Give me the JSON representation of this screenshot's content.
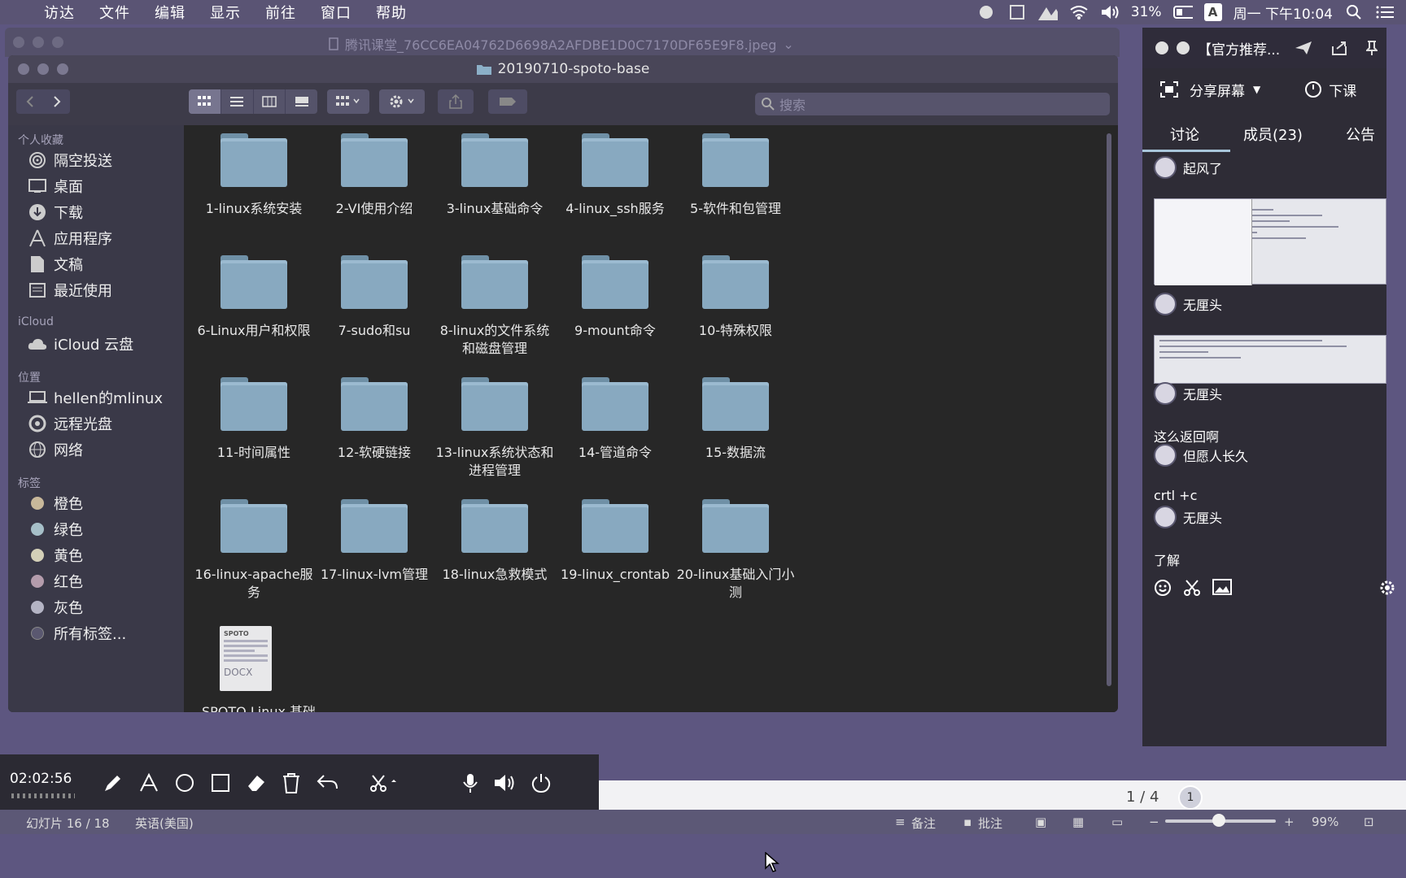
{
  "menubar": {
    "menus": [
      "访达",
      "文件",
      "编辑",
      "显示",
      "前往",
      "窗口",
      "帮助"
    ],
    "battery": "31%",
    "input_method": "A",
    "datetime": "周一 下午10:04"
  },
  "preview_window": {
    "title": "腾讯课堂_76CC6EA04762D6698A2AFDBE1D0C7170DF65E9F8.jpeg"
  },
  "finder": {
    "title": "20190710-spoto-base",
    "search_placeholder": "搜索",
    "sidebar": {
      "favorites_header": "个人收藏",
      "favorites": [
        "隔空投送",
        "桌面",
        "下载",
        "应用程序",
        "文稿",
        "最近使用"
      ],
      "icloud_header": "iCloud",
      "icloud_items": [
        "iCloud 云盘"
      ],
      "locations_header": "位置",
      "locations": [
        "hellen的mlinux",
        "远程光盘",
        "网络"
      ],
      "tags_header": "标签",
      "tags": [
        {
          "label": "橙色",
          "color": "#c8b89a"
        },
        {
          "label": "绿色",
          "color": "#a6bfc8"
        },
        {
          "label": "黄色",
          "color": "#d4d0b8"
        },
        {
          "label": "红色",
          "color": "#b49cac"
        },
        {
          "label": "灰色",
          "color": "#b4b4c4"
        }
      ],
      "all_tags": "所有标签..."
    },
    "folders": [
      "1-linux系统安装",
      "2-VI使用介绍",
      "3-linux基础命令",
      "4-linux_ssh服务",
      "5-软件和包管理",
      "6-Linux用户和权限",
      "7-sudo和su",
      "8-linux的文件系统和磁盘管理",
      "9-mount命令",
      "10-特殊权限",
      "11-时间属性",
      "12-软硬链接",
      "13-linux系统状态和进程管理",
      "14-管道命令",
      "15-数据流",
      "16-linux-apache服务",
      "17-linux-lvm管理",
      "18-linux急救模式",
      "19-linux_crontab",
      "20-linux基础入门小测"
    ],
    "doc_file": {
      "name": "SPOTO Linux 基础",
      "ext": "DOCX",
      "brand": "SPOTO"
    }
  },
  "chat": {
    "title": "【官方推荐...",
    "share_label": "分享屏幕",
    "end_label": "下课",
    "tabs": [
      "讨论",
      "成员(23)",
      "公告"
    ],
    "messages": [
      {
        "user": "起风了",
        "text": ""
      },
      {
        "user": "无厘头",
        "text": ""
      },
      {
        "user": "无厘头",
        "text": "这么返回啊"
      },
      {
        "user": "但愿人长久",
        "text": "crtl +c"
      },
      {
        "user": "无厘头",
        "text": "了解"
      }
    ]
  },
  "bottom": {
    "timer": "02:02:56",
    "pager": "1 / 4",
    "pager_circle": "1"
  },
  "statusbar": {
    "slide": "幻灯片 16 / 18",
    "language": "英语(美国)",
    "notes": "备注",
    "comments": "批注",
    "zoom": "99%"
  }
}
